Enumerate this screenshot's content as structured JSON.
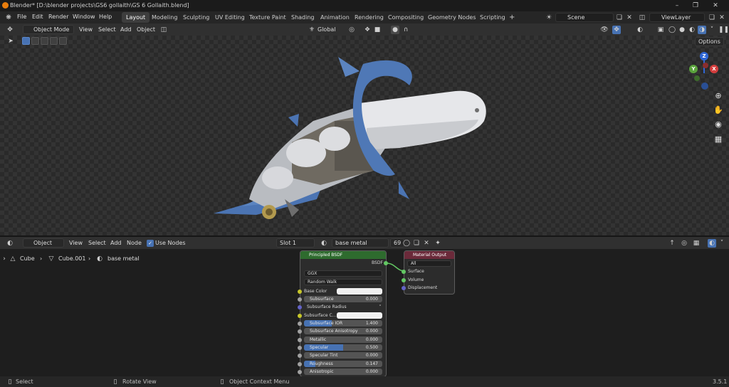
{
  "window": {
    "title": "Blender* [D:\\blender projects\\GS6 gollaith\\GS 6 Gollaith.blend]"
  },
  "menus": [
    "File",
    "Edit",
    "Render",
    "Window",
    "Help"
  ],
  "workspaces": [
    "Layout",
    "Modeling",
    "Sculpting",
    "UV Editing",
    "Texture Paint",
    "Shading",
    "Animation",
    "Rendering",
    "Compositing",
    "Geometry Nodes",
    "Scripting"
  ],
  "add_tab": "+",
  "scene": {
    "name": "Scene"
  },
  "view_layer": {
    "name": "ViewLayer"
  },
  "viewport_header": {
    "mode": "Object Mode",
    "items": [
      "View",
      "Select",
      "Add",
      "Object"
    ],
    "transform": "Global",
    "options": "Options"
  },
  "gizmo": {
    "x": "X",
    "y": "Y",
    "z": "Z"
  },
  "node_header": {
    "type": "Object",
    "items": [
      "View",
      "Select",
      "Add",
      "Node"
    ],
    "use_nodes": "Use Nodes",
    "slot": "Slot 1",
    "material": "base metal",
    "users": "69"
  },
  "breadcrumb": [
    "Cube",
    "Cube.001",
    "base metal"
  ],
  "bsdf_node": {
    "title": "Principled BSDF",
    "output": "BSDF",
    "distribution": "GGX",
    "subsurface_method": "Random Walk",
    "base_color_label": "Base Color",
    "subsurface_radius": "Subsurface Radius",
    "subsurface_color_label": "Subsurface C...",
    "base_color": "#f0f0f0",
    "subsurface_color": "#f2f2f2",
    "inputs": [
      {
        "label": "Subsurface",
        "value": "0.000",
        "fill": 0
      },
      {
        "label": "Subsurface IOR",
        "value": "1.400",
        "fill": 0.35
      },
      {
        "label": "Subsurface Anisotropy",
        "value": "0.000",
        "fill": 0
      },
      {
        "label": "Metallic",
        "value": "0.000",
        "fill": 0
      },
      {
        "label": "Specular",
        "value": "0.500",
        "fill": 0.5
      },
      {
        "label": "Specular Tint",
        "value": "0.000",
        "fill": 0
      },
      {
        "label": "Roughness",
        "value": "0.147",
        "fill": 0.147
      },
      {
        "label": "Anisotropic",
        "value": "0.000",
        "fill": 0
      }
    ]
  },
  "output_node": {
    "title": "Material Output",
    "target": "All",
    "sockets": [
      "Surface",
      "Volume",
      "Displacement"
    ]
  },
  "status": {
    "left": "Select",
    "middle": "Rotate View",
    "right": "Object Context Menu",
    "version": "3.5.1"
  },
  "colors": {
    "accent": "#4772b3",
    "shader_header": "#2e6b2e",
    "output_header": "#6b2a3a",
    "socket_green": "#63c763",
    "socket_yellow": "#c7c729",
    "socket_gray": "#a1a1a1",
    "socket_purple": "#6363c7"
  }
}
